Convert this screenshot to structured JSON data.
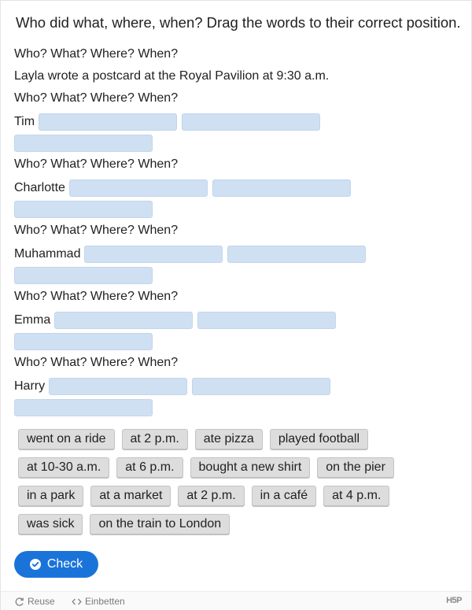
{
  "title": "Who did what, where, when? Drag the words to their correct position.",
  "header_line": "Who? What? Where? When?",
  "example": "Layla wrote a postcard at the Royal Pavilion at 9:30 a.m.",
  "sentences": [
    {
      "prompt": "Who? What? Where? When?",
      "name": "Tim"
    },
    {
      "prompt": "Who? What? Where? When?",
      "name": "Charlotte"
    },
    {
      "prompt": "Who? What? Where? When?",
      "name": "Muhammad"
    },
    {
      "prompt": "Who? What? Where? When?",
      "name": "Emma"
    },
    {
      "prompt": "Who? What? Where? When?",
      "name": "Harry"
    }
  ],
  "words": [
    [
      "went on a ride",
      "at 2 p.m.",
      "ate pizza",
      "played football"
    ],
    [
      "at 10-30 a.m.",
      "at 6 p.m.",
      "bought a new shirt",
      "on the pier"
    ],
    [
      "in a park",
      "at a market",
      "at 2 p.m.",
      "in a café",
      "at 4 p.m."
    ],
    [
      "was sick",
      "on the train to London"
    ]
  ],
  "check_label": "Check",
  "footer": {
    "reuse": "Reuse",
    "embed": "Einbetten",
    "logo": "H5P"
  },
  "colors": {
    "accent": "#1a73d9",
    "dropzone": "#cfe0f3",
    "word_bg": "#dddddd"
  }
}
